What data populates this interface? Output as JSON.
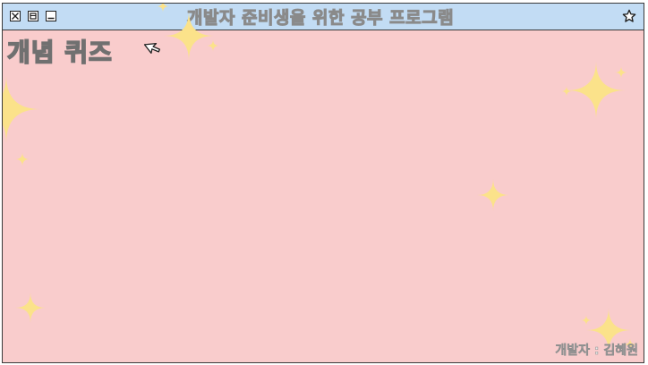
{
  "window": {
    "title": "개발자 준비생을 위한 공부 프로그램",
    "buttons": [
      "close-icon",
      "maximize-icon",
      "minimize-icon"
    ],
    "favorite_icon": "star-outline-icon"
  },
  "main": {
    "heading": "개념 퀴즈",
    "credit": "개발자 : 김혜원"
  },
  "colors": {
    "titlebar": "#c2dcf4",
    "background": "#f9cccc",
    "sparkle": "#fbe28a"
  }
}
